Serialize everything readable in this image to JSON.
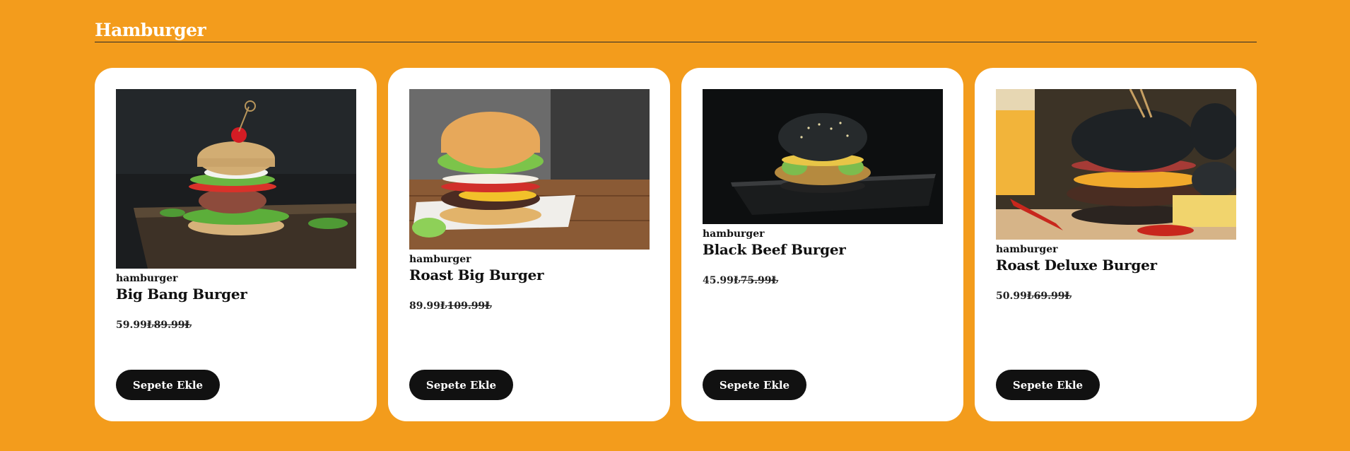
{
  "section": {
    "title": "Hamburger"
  },
  "products": [
    {
      "category": "hamburger",
      "name": "Big Bang Burger",
      "price": "59.99₺",
      "old_price": "89.99₺",
      "button": "Sepete Ekle"
    },
    {
      "category": "hamburger",
      "name": "Roast Big Burger",
      "price": "89.99₺",
      "old_price": "109.99₺",
      "button": "Sepete Ekle"
    },
    {
      "category": "hamburger",
      "name": "Black Beef Burger",
      "price": "45.99₺",
      "old_price": "75.99₺",
      "button": "Sepete Ekle"
    },
    {
      "category": "hamburger",
      "name": "Roast Deluxe Burger",
      "price": "50.99₺",
      "old_price": "69.99₺",
      "button": "Sepete Ekle"
    }
  ],
  "colors": {
    "background": "#F39C1C",
    "card": "#FFFFFF",
    "button": "#111111"
  }
}
